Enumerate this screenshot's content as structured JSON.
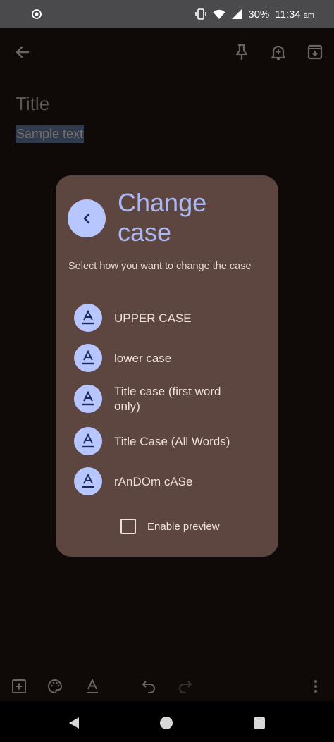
{
  "status_bar": {
    "battery": "30%",
    "time": "11:34",
    "ampm": "am",
    "icons": [
      "record-icon",
      "vibrate-icon",
      "wifi-icon",
      "signal-icon"
    ]
  },
  "toolbar": {
    "icons": [
      "back-arrow-icon",
      "pin-icon",
      "reminder-icon",
      "archive-icon"
    ]
  },
  "note": {
    "title_placeholder": "Title",
    "body_text": "Sample text"
  },
  "dialog": {
    "title": "Change case",
    "subtitle": "Select how you want to change the case",
    "options": [
      {
        "label": "UPPER CASE"
      },
      {
        "label": "lower case"
      },
      {
        "label": "Title case (first word only)"
      },
      {
        "label": "Title Case (All Words)"
      },
      {
        "label": "rAnDOm cASe"
      }
    ],
    "preview_label": "Enable preview",
    "preview_checked": false
  },
  "bottom_toolbar": {
    "icons": [
      "add-box-icon",
      "palette-icon",
      "text-format-icon",
      "undo-icon",
      "redo-icon",
      "more-vert-icon"
    ]
  },
  "nav_bar": {
    "icons": [
      "nav-back-icon",
      "nav-home-icon",
      "nav-recents-icon"
    ]
  },
  "colors": {
    "dialog_bg": "#5d4640",
    "accent": "#b7c6ff",
    "title": "#aab9f5"
  }
}
